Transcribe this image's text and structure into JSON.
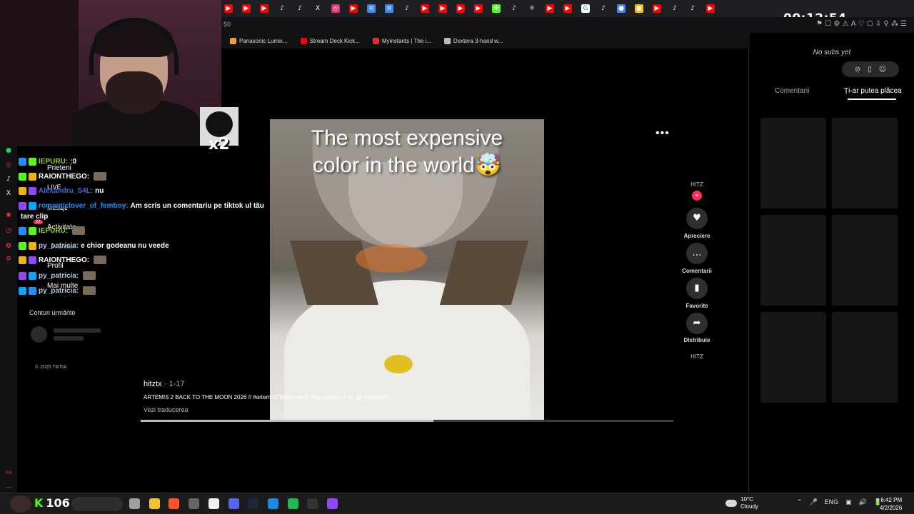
{
  "overlay": {
    "timer": "00:12:54",
    "alert_multiplier": "x2"
  },
  "browser": {
    "address_fragment": "50",
    "tab_icons": [
      {
        "name": "youtube-icon",
        "color": "#ff0000",
        "glyph": "▶"
      },
      {
        "name": "youtube-icon",
        "color": "#ff0000",
        "glyph": "▶"
      },
      {
        "name": "youtube-icon",
        "color": "#ff0000",
        "glyph": "▶"
      },
      {
        "name": "tiktok-icon",
        "color": "#1e1f22",
        "glyph": "♪"
      },
      {
        "name": "tiktok-icon",
        "color": "#1e1f22",
        "glyph": "♪"
      },
      {
        "name": "x-icon",
        "color": "#1e1f22",
        "glyph": "X"
      },
      {
        "name": "instagram-icon",
        "color": "#e1306c",
        "glyph": "◎"
      },
      {
        "name": "youtube-icon",
        "color": "#ff0000",
        "glyph": "▶"
      },
      {
        "name": "docs-icon",
        "color": "#4285f4",
        "glyph": "≡"
      },
      {
        "name": "docs-icon",
        "color": "#4285f4",
        "glyph": "≡"
      },
      {
        "name": "tiktok-icon",
        "color": "#1e1f22",
        "glyph": "♪"
      },
      {
        "name": "youtube-icon",
        "color": "#ff0000",
        "glyph": "▶"
      },
      {
        "name": "youtube-icon",
        "color": "#ff0000",
        "glyph": "▶"
      },
      {
        "name": "youtube-icon",
        "color": "#ff0000",
        "glyph": "▶"
      },
      {
        "name": "youtube-icon",
        "color": "#ff0000",
        "glyph": "▶"
      },
      {
        "name": "game-icon",
        "color": "#53fc18",
        "glyph": "✚"
      },
      {
        "name": "tiktok-icon",
        "color": "#1e1f22",
        "glyph": "♪"
      },
      {
        "name": "app-icon",
        "color": "#1e1f22",
        "glyph": "⚛"
      },
      {
        "name": "youtube-icon",
        "color": "#ff0000",
        "glyph": "▶"
      },
      {
        "name": "youtube-icon",
        "color": "#ff0000",
        "glyph": "▶"
      },
      {
        "name": "google-icon",
        "color": "#ffffff",
        "glyph": "G"
      },
      {
        "name": "tiktok-icon",
        "color": "#1e1f22",
        "glyph": "♪"
      },
      {
        "name": "chrome-icon",
        "color": "#4285f4",
        "glyph": "●"
      },
      {
        "name": "chrome-icon",
        "color": "#fbbc05",
        "glyph": "●"
      },
      {
        "name": "youtube-icon",
        "color": "#ff0000",
        "glyph": "▶"
      },
      {
        "name": "tiktok-icon",
        "color": "#1e1f22",
        "glyph": "♪"
      },
      {
        "name": "tiktok-icon",
        "color": "#1e1f22",
        "glyph": "♪"
      },
      {
        "name": "youtube-icon",
        "color": "#ff0000",
        "glyph": "▶"
      }
    ],
    "toolbar_glyphs": "⚑ ☐ ⚙ ⚠ A ♡ ⬡ ⇩ ⚲ ⁂ ☰",
    "bookmarks": [
      {
        "label": "Panasonic Lumix...",
        "color": "#f0a030"
      },
      {
        "label": "Stream Deck Kick...",
        "color": "#ff0000"
      },
      {
        "label": "Myinstants | The i...",
        "color": "#e03030"
      },
      {
        "label": "Dextera 3-hand w...",
        "color": "#bbbbbb"
      }
    ]
  },
  "tiktok_nav": {
    "items": [
      "Prieteni",
      "LIVE",
      "Mesaje",
      "Activitate",
      "Încărcare",
      "Profil",
      "Mai multe"
    ],
    "badge": "22",
    "followed_title": "Conturi urmărite",
    "copyright": "© 2026 TikTok"
  },
  "chat": {
    "lines": [
      {
        "name": "",
        "text": "",
        "name_color": "#00ff7f"
      },
      {
        "name": "IEPURU:",
        "text": ":0",
        "name_color": "#9acd32"
      },
      {
        "name": "RAIONTHEGO:",
        "text": "",
        "name_color": "#ffffff"
      },
      {
        "name": "Alexandru_S4L:",
        "text": "nu",
        "name_color": "#4169e1"
      },
      {
        "name": "romanticlover_of_femboy:",
        "text": "Am scris un comentariu pe tiktok ul tău",
        "name_color": "#1e90ff"
      },
      {
        "name": "",
        "text": "tare clip",
        "name_color": "#ffffff"
      },
      {
        "name": "IEPURU:",
        "text": "",
        "name_color": "#9acd32"
      },
      {
        "name": "py_patricia:",
        "text": "e chior godeanu nu veede",
        "name_color": "#b0c4de"
      },
      {
        "name": "RAIONTHEGO:",
        "text": "",
        "name_color": "#ffffff"
      },
      {
        "name": "py_patricia:",
        "text": "",
        "name_color": "#b0c4de"
      },
      {
        "name": "py_patricia:",
        "text": "",
        "name_color": "#b0c4de"
      }
    ]
  },
  "video": {
    "caption_line1": "The most expensive",
    "caption_line2": "color in the world🤯",
    "author": "hitztx",
    "date": " · 1-17",
    "description": "ARTEMIS 2 BACK TO THE MOON 2026 // #artemis2 #nasa #edit #fyp #space // ib: @_razoredits_",
    "translate": "Vezi traducerea",
    "progress": 0.55,
    "more": "•••"
  },
  "rail": {
    "handle": "HITZ",
    "follow": "+",
    "actions": [
      {
        "label": "Apreciere",
        "glyph": "♥"
      },
      {
        "label": "Comentarii",
        "glyph": "…"
      },
      {
        "label": "Favorite",
        "glyph": "▮"
      },
      {
        "label": "Distribuie",
        "glyph": "➦"
      }
    ],
    "handle2": "HITZ"
  },
  "right_panel": {
    "no_subs": "No subs yet",
    "pill_glyphs": [
      "⊘",
      "▯",
      "☺"
    ],
    "tabs": [
      "Comentarii",
      "Ți-ar putea plăcea"
    ]
  },
  "taskbar": {
    "kick_label": "K",
    "kick_count": "106",
    "weather_temp": "10°C",
    "weather_desc": "Cloudy",
    "tray_items": [
      "⌃",
      "🎤",
      "ENG",
      "▣",
      "🔊",
      "🔋"
    ],
    "time": "6:42 PM",
    "date": "4/2/2026",
    "app_colors": [
      "#9aa0a6",
      "#f4c430",
      "#fb542b",
      "#666666",
      "#f0f0f0",
      "#5865f2",
      "#1b2838",
      "#1e88e5",
      "#1db954",
      "#333333",
      "#9146ff"
    ]
  }
}
